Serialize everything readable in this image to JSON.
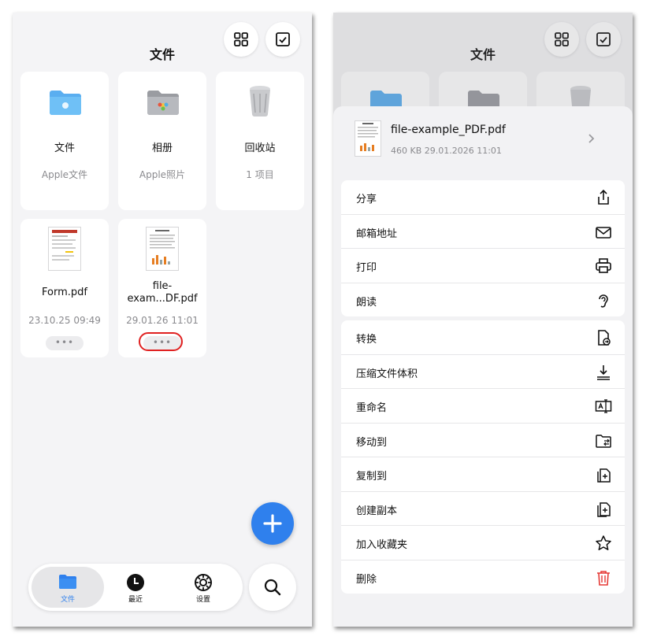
{
  "left": {
    "title": "文件",
    "tiles": [
      {
        "name": "文件",
        "sub": "Apple文件",
        "icon": "blue-folder-icon"
      },
      {
        "name": "相册",
        "sub": "Apple照片",
        "icon": "photos-folder-icon"
      },
      {
        "name": "回收站",
        "sub": "1 项目",
        "icon": "trash-can-icon"
      },
      {
        "name": "Form.pdf",
        "sub": "23.10.25 09:49",
        "icon": "pdf-thumbnail"
      },
      {
        "name1": "file-",
        "name2": "exam...DF.pdf",
        "sub": "29.01.26 11:01",
        "icon": "pdf-thumbnail"
      }
    ],
    "more_label": "•••",
    "tabs": [
      {
        "label": "文件",
        "icon": "folder-icon",
        "active": true
      },
      {
        "label": "最近",
        "icon": "clock-icon",
        "active": false
      },
      {
        "label": "设置",
        "icon": "gear-icon",
        "active": false
      }
    ],
    "accent": "#2f80ed"
  },
  "right": {
    "title": "文件",
    "file": {
      "name": "file-example_PDF.pdf",
      "meta": "460 KB 29.01.2026 11:01"
    },
    "group1": [
      {
        "label": "分享",
        "icon": "share-icon"
      },
      {
        "label": "邮箱地址",
        "icon": "mail-icon"
      },
      {
        "label": "打印",
        "icon": "printer-icon"
      },
      {
        "label": "朗读",
        "icon": "ear-icon"
      }
    ],
    "group2": [
      {
        "label": "转换",
        "icon": "convert-icon"
      },
      {
        "label": "压缩文件体积",
        "icon": "download-icon"
      },
      {
        "label": "重命名",
        "icon": "rename-icon"
      },
      {
        "label": "移动到",
        "icon": "move-folder-icon"
      },
      {
        "label": "复制到",
        "icon": "copy-to-icon"
      },
      {
        "label": "创建副本",
        "icon": "duplicate-icon"
      },
      {
        "label": "加入收藏夹",
        "icon": "star-icon"
      },
      {
        "label": "删除",
        "icon": "trash-icon"
      }
    ],
    "delete_color": "#e53935"
  }
}
